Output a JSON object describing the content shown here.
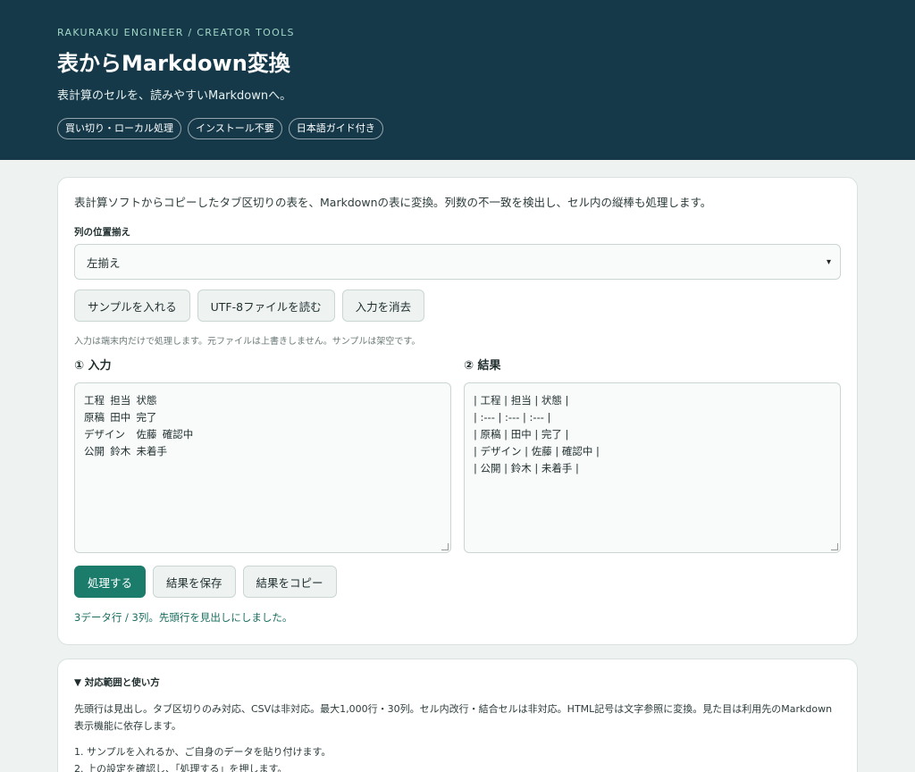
{
  "hero": {
    "eyebrow": "RAKURAKU ENGINEER / CREATOR TOOLS",
    "title": "表からMarkdown変換",
    "subtitle": "表計算のセルを、読みやすいMarkdownへ。",
    "chips": [
      "買い切り・ローカル処理",
      "インストール不要",
      "日本語ガイド付き"
    ]
  },
  "main": {
    "description": "表計算ソフトからコピーしたタブ区切りの表を、Markdownの表に変換。列数の不一致を検出し、セル内の縦棒も処理します。",
    "align_label": "列の位置揃え",
    "align_value": "左揃え",
    "buttons": {
      "sample": "サンプルを入れる",
      "read_file": "UTF-8ファイルを読む",
      "clear": "入力を消去"
    },
    "note": "入力は端末内だけで処理します。元ファイルは上書きしません。サンプルは架空です。",
    "input_heading": "① 入力",
    "output_heading": "② 結果",
    "input_lines": [
      "工程\t担当\t状態",
      "原稿\t田中\t完了",
      "デザイン\t佐藤\t確認中",
      "公開\t鈴木\t未着手"
    ],
    "output_lines": [
      "| 工程 | 担当 | 状態 |",
      "| :--- | :--- | :--- |",
      "| 原稿 | 田中 | 完了 |",
      "| デザイン | 佐藤 | 確認中 |",
      "| 公開 | 鈴木 | 未着手 |"
    ],
    "actions": {
      "process": "処理する",
      "save": "結果を保存",
      "copy": "結果をコピー"
    },
    "status": "3データ行 / 3列。先頭行を見出しにしました。"
  },
  "guide": {
    "title": "▼ 対応範囲と使い方",
    "text": "先頭行は見出し。タブ区切りのみ対応、CSVは非対応。最大1,000行・30列。セル内改行・結合セルは非対応。HTML記号は文字参照に変換。見た目は利用先のMarkdown表示機能に依存します。",
    "steps": [
      "1. サンプルを入れるか、ご自身のデータを貼り付けます。",
      "2. 上の設定を確認し、「処理する」を押します。"
    ]
  },
  "colors": {
    "hero_bg": "#16394a",
    "accent": "#1b7c6b",
    "page_bg": "#eef2f1"
  }
}
